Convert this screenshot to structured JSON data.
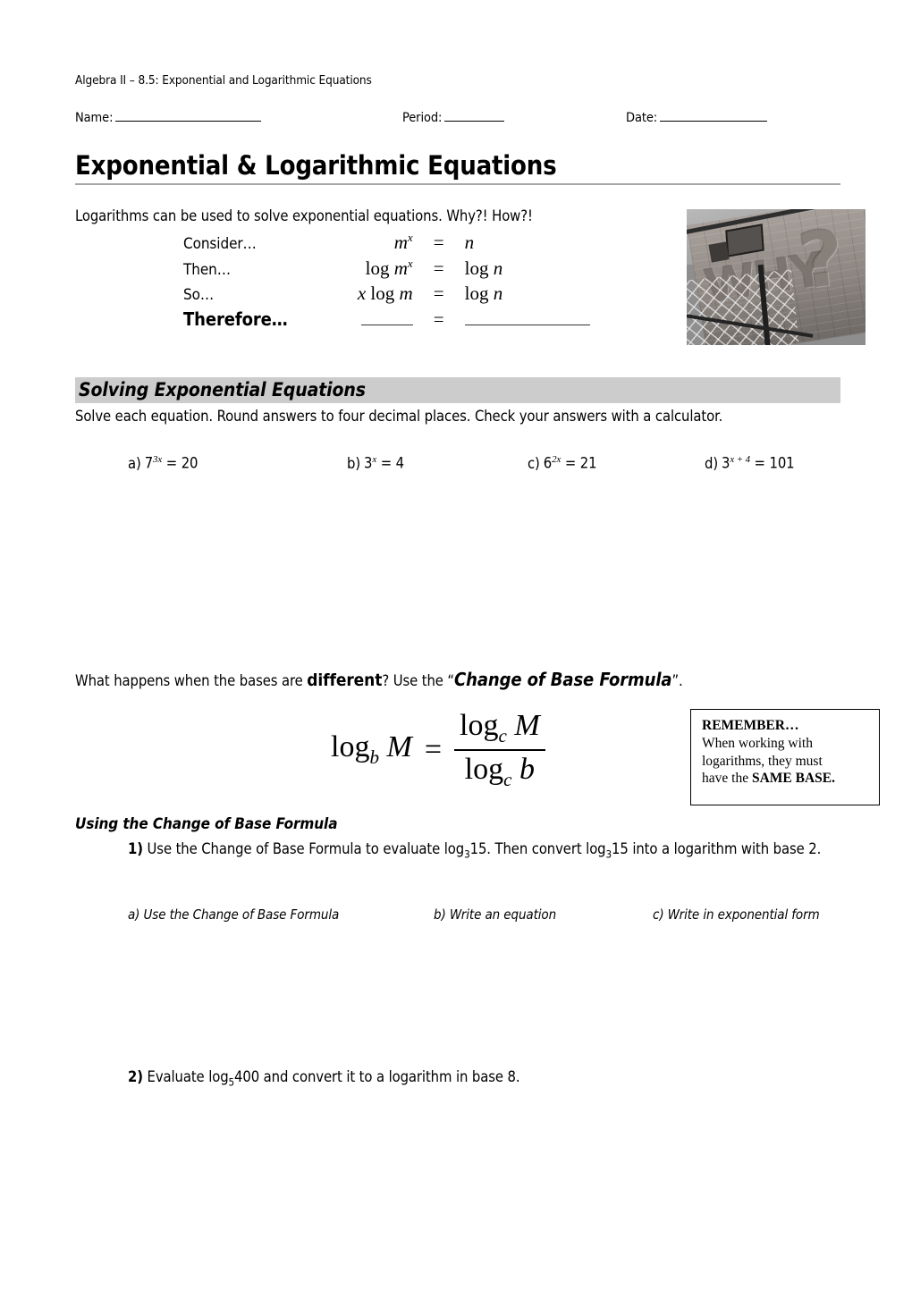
{
  "header": {
    "course_line": "Algebra II – 8.5: Exponential and Logarithmic Equations",
    "name_label": "Name:",
    "period_label": "Period:",
    "date_label": "Date:"
  },
  "title": "Exponential & Logarithmic Equations",
  "intro": {
    "text": "Logarithms can be used to solve exponential equations. Why?! How?!",
    "rows": [
      {
        "lead": "Consider…",
        "lhs_base": "m",
        "lhs_sup": "x",
        "lhs_prefix": "",
        "eq": "=",
        "rhs": "n"
      },
      {
        "lead": "Then…",
        "lhs": "log m",
        "lhs_sup": "x",
        "eq": "=",
        "rhs": "log n"
      },
      {
        "lead": "So…",
        "lhs": "x log m",
        "eq": "=",
        "rhs": "log n"
      },
      {
        "lead": "Therefore…",
        "lhs": "",
        "eq": "=",
        "rhs": ""
      }
    ],
    "therefore_label": "Therefore…"
  },
  "photo": {
    "alt_word": "WHY",
    "alt_mark": "?"
  },
  "sections": {
    "solving": {
      "band_title": "Solving Exponential Equations",
      "instruction": "Solve each equation. Round answers to four decimal places. Check your answers with a calculator.",
      "problems": [
        {
          "label": "a)",
          "base": "7",
          "exp": "3x",
          "eq": "= 20"
        },
        {
          "label": "b)",
          "base": "3",
          "exp": "x",
          "eq": "= 4"
        },
        {
          "label": "c)",
          "base": "6",
          "exp": "2x",
          "eq": "= 21"
        },
        {
          "label": "d)",
          "base": "3",
          "exp": "x + 4",
          "eq": "= 101"
        }
      ]
    },
    "change_of_base": {
      "question_pre": "What happens when the bases are ",
      "question_bold": "different",
      "question_mid": "? Use the “",
      "question_bolditalic": "Change of Base Formula",
      "question_post": "”.",
      "formula": {
        "lhs_log": "log",
        "lhs_sub": "b",
        "lhs_arg": "M",
        "equals": "=",
        "num_log": "log",
        "num_sub": "c",
        "num_arg": "M",
        "den_log": "log",
        "den_sub": "c",
        "den_arg": "b"
      },
      "remember": {
        "heading": "REMEMBER…",
        "line1": "When working with",
        "line2": "logarithms, they must",
        "line3_pre": "have the ",
        "line3_bold": "SAME BASE."
      },
      "subhead": "Using the Change of Base Formula",
      "item1": {
        "number": "1)",
        "text_pre": " Use the Change of Base Formula to evaluate log",
        "sub1": "3",
        "text_mid": "15. Then convert log",
        "sub2": "3",
        "text_post": "15 into a logarithm with base 2."
      },
      "subparts": [
        "a) Use the Change of Base Formula",
        "b) Write an equation",
        "c) Write in exponential form"
      ],
      "item2": {
        "number": "2)",
        "text_pre": " Evaluate log",
        "sub1": "5",
        "text_post": "400 and convert it to a logarithm in base 8."
      }
    }
  }
}
